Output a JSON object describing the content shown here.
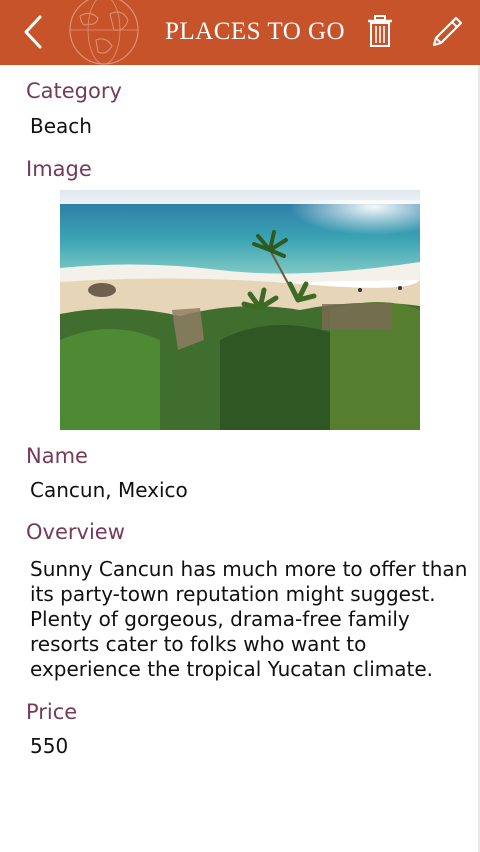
{
  "header": {
    "title": "PLACES TO GO",
    "background": "#c6532a",
    "back_icon": "chevron-left-icon",
    "globe_icon": "globe-icon",
    "delete_icon": "trash-icon",
    "edit_icon": "pencil-icon"
  },
  "colors": {
    "label": "#743b5a",
    "value": "#111111"
  },
  "details": {
    "category_label": "Category",
    "category_value": "Beach",
    "image_label": "Image",
    "image_icon": "beach-photo",
    "name_label": "Name",
    "name_value": "Cancun, Mexico",
    "overview_label": "Overview",
    "overview_value": "Sunny Cancun has much more to offer than its party-town reputation might suggest. Plenty of gorgeous, drama-free family resorts cater to folks who want to experience the tropical Yucatan climate.",
    "price_label": "Price",
    "price_value": "550"
  }
}
